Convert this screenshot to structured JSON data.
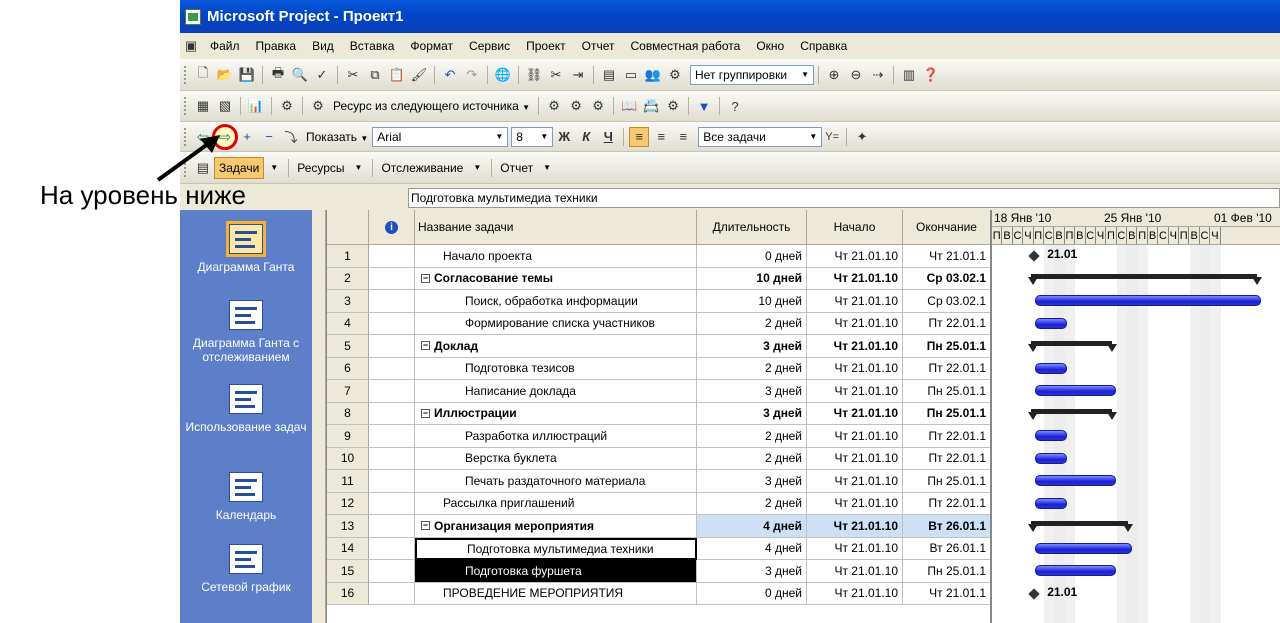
{
  "window": {
    "title": "Microsoft Project - Проект1"
  },
  "menu": [
    "Файл",
    "Правка",
    "Вид",
    "Вставка",
    "Формат",
    "Сервис",
    "Проект",
    "Отчет",
    "Совместная работа",
    "Окно",
    "Справка"
  ],
  "toolbar1": {
    "grouping": "Нет группировки"
  },
  "toolbar2": {
    "resource_from": "Ресурс из следующего источника"
  },
  "toolbar3": {
    "show_label": "Показать",
    "font": "Arial",
    "size": "8",
    "bold": "Ж",
    "italic": "К",
    "underline": "Ч",
    "filter": "Все задачи",
    "filter_icon": "Y="
  },
  "toolbar4": {
    "tasks": "Задачи",
    "resources": "Ресурсы",
    "tracking": "Отслеживание",
    "report": "Отчет"
  },
  "annotation": {
    "text": "На уровень ниже"
  },
  "formula_value": "Подготовка мультимедиа техники",
  "views": [
    {
      "label": "Диаграмма Ганта",
      "icon": "gantt-chart-icon"
    },
    {
      "label": "Диаграмма Ганта с отслеживанием",
      "icon": "tracking-gantt-icon"
    },
    {
      "label": "Использование задач",
      "icon": "task-usage-icon"
    },
    {
      "label": "Календарь",
      "icon": "calendar-icon"
    },
    {
      "label": "Сетевой график",
      "icon": "network-diagram-icon"
    }
  ],
  "columns": {
    "info": "i",
    "name": "Название задачи",
    "duration": "Длительность",
    "start": "Начало",
    "finish": "Окончание"
  },
  "gantt_header": {
    "months": [
      "18 Янв '10",
      "25 Янв '10",
      "01 Фев '10"
    ],
    "days": [
      "П",
      "В",
      "С",
      "Ч",
      "П",
      "С",
      "В",
      "П",
      "В",
      "С",
      "Ч",
      "П",
      "С",
      "В",
      "П",
      "В",
      "С",
      "Ч",
      "П"
    ]
  },
  "tasks": [
    {
      "id": "1",
      "name": "Начало проекта",
      "duration": "0 дней",
      "start": "Чт 21.01.10",
      "finish": "Чт 21.01.1",
      "level": 1,
      "summary": false,
      "milestone": true,
      "milestone_label": "21.01",
      "bar_start": 0,
      "bar_days": 0
    },
    {
      "id": "2",
      "name": "Согласование темы",
      "duration": "10 дней",
      "start": "Чт 21.01.10",
      "finish": "Ср 03.02.1",
      "level": 0,
      "summary": true,
      "bar_start": 0,
      "bar_days": 14
    },
    {
      "id": "3",
      "name": "Поиск, обработка информации",
      "duration": "10 дней",
      "start": "Чт 21.01.10",
      "finish": "Ср 03.02.1",
      "level": 2,
      "summary": false,
      "bar_start": 0,
      "bar_days": 14
    },
    {
      "id": "4",
      "name": "Формирование списка участников",
      "duration": "2 дней",
      "start": "Чт 21.01.10",
      "finish": "Пт 22.01.1",
      "level": 2,
      "summary": false,
      "bar_start": 0,
      "bar_days": 2
    },
    {
      "id": "5",
      "name": "Доклад",
      "duration": "3 дней",
      "start": "Чт 21.01.10",
      "finish": "Пн 25.01.1",
      "level": 0,
      "summary": true,
      "bar_start": 0,
      "bar_days": 5
    },
    {
      "id": "6",
      "name": "Подготовка тезисов",
      "duration": "2 дней",
      "start": "Чт 21.01.10",
      "finish": "Пт 22.01.1",
      "level": 2,
      "summary": false,
      "bar_start": 0,
      "bar_days": 2
    },
    {
      "id": "7",
      "name": "Написание доклада",
      "duration": "3 дней",
      "start": "Чт 21.01.10",
      "finish": "Пн 25.01.1",
      "level": 2,
      "summary": false,
      "bar_start": 0,
      "bar_days": 5
    },
    {
      "id": "8",
      "name": "Иллюстрации",
      "duration": "3 дней",
      "start": "Чт 21.01.10",
      "finish": "Пн 25.01.1",
      "level": 0,
      "summary": true,
      "bar_start": 0,
      "bar_days": 5
    },
    {
      "id": "9",
      "name": "Разработка иллюстраций",
      "duration": "2 дней",
      "start": "Чт 21.01.10",
      "finish": "Пт 22.01.1",
      "level": 2,
      "summary": false,
      "bar_start": 0,
      "bar_days": 2
    },
    {
      "id": "10",
      "name": "Верстка буклета",
      "duration": "2 дней",
      "start": "Чт 21.01.10",
      "finish": "Пт 22.01.1",
      "level": 2,
      "summary": false,
      "bar_start": 0,
      "bar_days": 2
    },
    {
      "id": "11",
      "name": "Печать раздаточного материала",
      "duration": "3 дней",
      "start": "Чт 21.01.10",
      "finish": "Пн 25.01.1",
      "level": 2,
      "summary": false,
      "bar_start": 0,
      "bar_days": 5
    },
    {
      "id": "12",
      "name": "Рассылка приглашений",
      "duration": "2 дней",
      "start": "Чт 21.01.10",
      "finish": "Пт 22.01.1",
      "level": 1,
      "summary": false,
      "bar_start": 0,
      "bar_days": 2
    },
    {
      "id": "13",
      "name": "Организация мероприятия",
      "duration": "4 дней",
      "start": "Чт 21.01.10",
      "finish": "Вт 26.01.1",
      "level": 0,
      "summary": true,
      "selected_row": true,
      "bar_start": 0,
      "bar_days": 6
    },
    {
      "id": "14",
      "name": "Подготовка мультимедиа техники",
      "duration": "4 дней",
      "start": "Чт 21.01.10",
      "finish": "Вт 26.01.1",
      "level": 2,
      "summary": false,
      "boxed": true,
      "bar_start": 0,
      "bar_days": 6
    },
    {
      "id": "15",
      "name": "Подготовка фуршета",
      "duration": "3 дней",
      "start": "Чт 21.01.10",
      "finish": "Пн 25.01.1",
      "level": 2,
      "summary": false,
      "inverted": true,
      "bar_start": 0,
      "bar_days": 5
    },
    {
      "id": "16",
      "name": "ПРОВЕДЕНИЕ МЕРОПРИЯТИЯ",
      "duration": "0 дней",
      "start": "Чт 21.01.10",
      "finish": "Чт 21.01.1",
      "level": 1,
      "summary": false,
      "milestone": true,
      "milestone_label": "21.01",
      "bar_start": 0,
      "bar_days": 0
    }
  ]
}
